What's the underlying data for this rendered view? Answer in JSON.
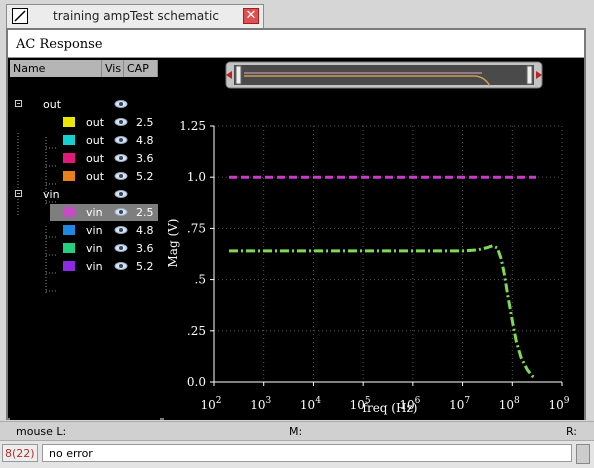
{
  "window": {
    "tab_title": "training ampTest schematic",
    "close_glyph": "✕"
  },
  "panel": {
    "title": "AC Response",
    "columns": {
      "name": "Name",
      "vis": "Vis",
      "cap": "CAP"
    },
    "groups": [
      {
        "label": "out",
        "traces": [
          {
            "label": "out",
            "cap": "2.5",
            "color": "#e8e800"
          },
          {
            "label": "out",
            "cap": "4.8",
            "color": "#14d0d0"
          },
          {
            "label": "out",
            "cap": "3.6",
            "color": "#e0197a"
          },
          {
            "label": "out",
            "cap": "5.2",
            "color": "#e8801a"
          }
        ]
      },
      {
        "label": "vin",
        "traces": [
          {
            "label": "vin",
            "cap": "2.5",
            "color": "#c64cc6",
            "selected": true
          },
          {
            "label": "vin",
            "cap": "4.8",
            "color": "#1e88e5"
          },
          {
            "label": "vin",
            "cap": "3.6",
            "color": "#22d080"
          },
          {
            "label": "vin",
            "cap": "5.2",
            "color": "#8a2be2"
          }
        ]
      }
    ]
  },
  "status": {
    "mouse_l": "mouse L:",
    "mouse_m": "M:",
    "mouse_r": "R:",
    "line_no": "8(22)",
    "message": "no error"
  },
  "chart_data": {
    "type": "line",
    "xlabel": "freq (Hz)",
    "ylabel": "Mag (V)",
    "xscale": "log",
    "xlim": [
      100,
      1000000000
    ],
    "ylim": [
      0,
      1.25
    ],
    "x_tick_exponents": [
      2,
      3,
      4,
      5,
      6,
      7,
      8,
      9
    ],
    "x_tick_base": "10",
    "y_ticks": [
      "0.0",
      ".25",
      ".5",
      ".75",
      "1.0",
      "1.25"
    ],
    "y_tick_values": [
      0,
      0.25,
      0.5,
      0.75,
      1.0,
      1.25
    ],
    "grid": true,
    "series": [
      {
        "color": "#c83cc8",
        "dash": "8,4",
        "points": [
          [
            200,
            1.0
          ],
          [
            300000000,
            1.0
          ]
        ]
      },
      {
        "color": "#7ed957",
        "dash": "9,3,2,3",
        "points": [
          [
            200,
            0.64
          ],
          [
            1000000,
            0.64
          ],
          [
            10000000,
            0.64
          ],
          [
            20000000,
            0.645
          ],
          [
            30000000,
            0.655
          ],
          [
            40000000,
            0.665
          ],
          [
            50000000,
            0.655
          ],
          [
            60000000,
            0.6
          ],
          [
            70000000,
            0.52
          ],
          [
            80000000,
            0.43
          ],
          [
            100000000,
            0.3
          ],
          [
            120000000,
            0.2
          ],
          [
            150000000,
            0.12
          ],
          [
            200000000,
            0.06
          ],
          [
            250000000,
            0.03
          ],
          [
            300000000,
            0.02
          ]
        ]
      }
    ]
  }
}
